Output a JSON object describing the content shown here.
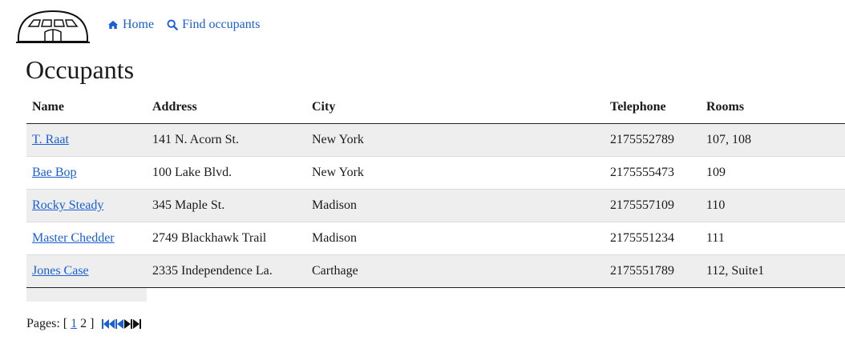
{
  "nav": {
    "home_label": "Home",
    "find_label": "Find occupants"
  },
  "page_title": "Occupants",
  "table": {
    "headers": [
      "Name",
      "Address",
      "City",
      "Telephone",
      "Rooms"
    ],
    "rows": [
      [
        "T. Raat",
        "141 N. Acorn St.",
        "New York",
        "2175552789",
        "107, 108"
      ],
      [
        "Bae Bop",
        "100 Lake Blvd.",
        "New York",
        "2175555473",
        "109"
      ],
      [
        "Rocky Steady",
        "345 Maple St.",
        "Madison",
        "2175557109",
        "110"
      ],
      [
        "Master Chedder",
        "2749 Blackhawk Trail",
        "Madison",
        "2175551234",
        "111"
      ],
      [
        "Jones Case",
        "2335 Independence La.",
        "Carthage",
        "2175551789",
        "112, Suite1"
      ]
    ]
  },
  "pager": {
    "label": "Pages:",
    "open": "[",
    "close": "]",
    "pages": [
      "1",
      "2"
    ]
  },
  "colors": {
    "link": "#1a5fd6",
    "row_alt": "#eeeeee"
  }
}
